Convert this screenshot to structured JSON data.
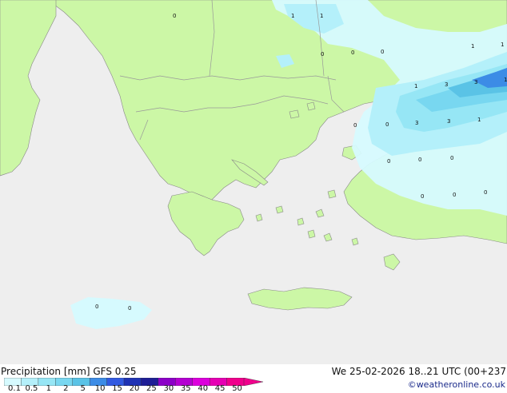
{
  "title": {
    "left": "Precipitation [mm]  GFS 0.25",
    "right": "We 25-02-2026 18..21 UTC (00+237"
  },
  "credit": "©weatheronline.co.uk",
  "legend": {
    "ticks": [
      "0.1",
      "0.5",
      "1",
      "2",
      "5",
      "10",
      "15",
      "20",
      "25",
      "30",
      "35",
      "40",
      "45",
      "50"
    ],
    "colors": [
      "#d6fafe",
      "#b4f0fa",
      "#96e6f5",
      "#78d7f0",
      "#5ac3e6",
      "#3c8ce6",
      "#325ae1",
      "#1e32b4",
      "#1e1e96",
      "#8c00c8",
      "#b400d2",
      "#dc00dc",
      "#e600b4",
      "#f0008c"
    ]
  },
  "colors": {
    "sea": "#eeeeee",
    "land": "#ccf7a6",
    "border": "#999999",
    "coast": "#888888"
  },
  "point_values": [
    "0",
    "1",
    "1",
    "0",
    "0",
    "0",
    "1",
    "1",
    "1",
    "3",
    "3",
    "3",
    "3",
    "1",
    "1",
    "0",
    "0",
    "0",
    "0",
    "0",
    "0",
    "0",
    "0",
    "0",
    "0"
  ]
}
